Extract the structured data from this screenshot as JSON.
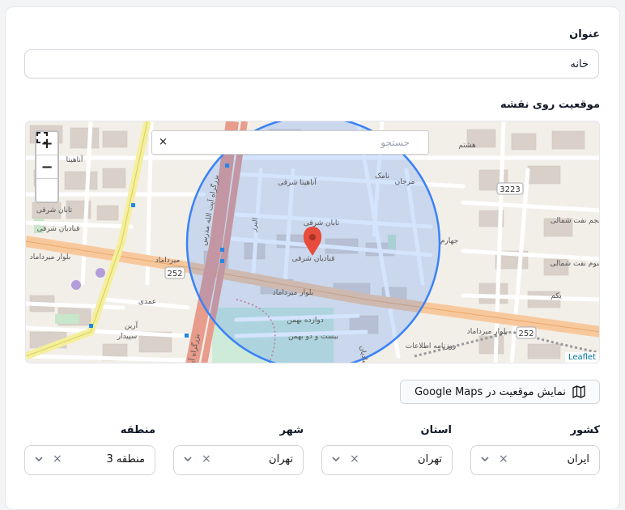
{
  "form": {
    "title_label": "عنوان",
    "title_value": "خانه",
    "map_label": "موقعیت روی نقشه",
    "google_button_label": "نمایش موقعیت در Google Maps"
  },
  "map": {
    "search_placeholder": "جستجو",
    "clear_symbol": "×",
    "zoom_in": "+",
    "zoom_out": "−",
    "attribution": "Leaflet",
    "streets": {
      "s1": "آناهیتا شرقی",
      "s2": "تابان شرقی",
      "s3": "قبادیان شرقی",
      "s4": "بلوار میرداماد",
      "s5": "بلوار میرداماد",
      "s6": "دوازده بهمن",
      "s7": "بیست و دو بهمن",
      "s8": "بزرگراه آیت الله مدرس",
      "s9": "قبادیان شرقی",
      "s10": "تابان شرقی",
      "s11": "آناهیتا",
      "s12": "البرز",
      "s13": "پنجم نفت شمالی",
      "s14": "سوم نفت شمالی",
      "s15": "یکم",
      "s16": "هشتم",
      "s17": "جهارم",
      "s18": "مرجان",
      "s19": "نامک",
      "s20": "میرداماد",
      "s21": "عمدی",
      "s22": "آرین",
      "s23": "سپیدار",
      "s24": "بزرگراه آیت",
      "s25": "بلوار میرداماد",
      "s26": "روزنامه اطلاعات",
      "s27": "قبادیان"
    },
    "shields": {
      "a": "252",
      "b": "252",
      "c": "3223"
    }
  },
  "location": {
    "country_label": "کشور",
    "country_value": "ایران",
    "province_label": "استان",
    "province_value": "تهران",
    "city_label": "شهر",
    "city_value": "تهران",
    "region_label": "منطقه",
    "region_value": "منطقه 3",
    "clear_symbol": "×"
  },
  "colors": {
    "accent_circle": "#3b82f6",
    "marker": "#e74c3c"
  }
}
